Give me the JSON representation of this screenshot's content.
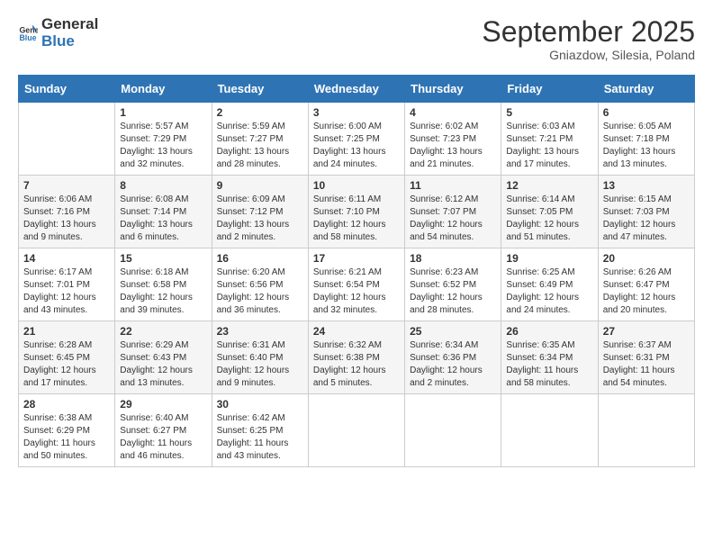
{
  "logo": {
    "general": "General",
    "blue": "Blue"
  },
  "title": "September 2025",
  "subtitle": "Gniazdow, Silesia, Poland",
  "weekdays": [
    "Sunday",
    "Monday",
    "Tuesday",
    "Wednesday",
    "Thursday",
    "Friday",
    "Saturday"
  ],
  "weeks": [
    [
      {
        "day": "",
        "info": ""
      },
      {
        "day": "1",
        "info": "Sunrise: 5:57 AM\nSunset: 7:29 PM\nDaylight: 13 hours\nand 32 minutes."
      },
      {
        "day": "2",
        "info": "Sunrise: 5:59 AM\nSunset: 7:27 PM\nDaylight: 13 hours\nand 28 minutes."
      },
      {
        "day": "3",
        "info": "Sunrise: 6:00 AM\nSunset: 7:25 PM\nDaylight: 13 hours\nand 24 minutes."
      },
      {
        "day": "4",
        "info": "Sunrise: 6:02 AM\nSunset: 7:23 PM\nDaylight: 13 hours\nand 21 minutes."
      },
      {
        "day": "5",
        "info": "Sunrise: 6:03 AM\nSunset: 7:21 PM\nDaylight: 13 hours\nand 17 minutes."
      },
      {
        "day": "6",
        "info": "Sunrise: 6:05 AM\nSunset: 7:18 PM\nDaylight: 13 hours\nand 13 minutes."
      }
    ],
    [
      {
        "day": "7",
        "info": "Sunrise: 6:06 AM\nSunset: 7:16 PM\nDaylight: 13 hours\nand 9 minutes."
      },
      {
        "day": "8",
        "info": "Sunrise: 6:08 AM\nSunset: 7:14 PM\nDaylight: 13 hours\nand 6 minutes."
      },
      {
        "day": "9",
        "info": "Sunrise: 6:09 AM\nSunset: 7:12 PM\nDaylight: 13 hours\nand 2 minutes."
      },
      {
        "day": "10",
        "info": "Sunrise: 6:11 AM\nSunset: 7:10 PM\nDaylight: 12 hours\nand 58 minutes."
      },
      {
        "day": "11",
        "info": "Sunrise: 6:12 AM\nSunset: 7:07 PM\nDaylight: 12 hours\nand 54 minutes."
      },
      {
        "day": "12",
        "info": "Sunrise: 6:14 AM\nSunset: 7:05 PM\nDaylight: 12 hours\nand 51 minutes."
      },
      {
        "day": "13",
        "info": "Sunrise: 6:15 AM\nSunset: 7:03 PM\nDaylight: 12 hours\nand 47 minutes."
      }
    ],
    [
      {
        "day": "14",
        "info": "Sunrise: 6:17 AM\nSunset: 7:01 PM\nDaylight: 12 hours\nand 43 minutes."
      },
      {
        "day": "15",
        "info": "Sunrise: 6:18 AM\nSunset: 6:58 PM\nDaylight: 12 hours\nand 39 minutes."
      },
      {
        "day": "16",
        "info": "Sunrise: 6:20 AM\nSunset: 6:56 PM\nDaylight: 12 hours\nand 36 minutes."
      },
      {
        "day": "17",
        "info": "Sunrise: 6:21 AM\nSunset: 6:54 PM\nDaylight: 12 hours\nand 32 minutes."
      },
      {
        "day": "18",
        "info": "Sunrise: 6:23 AM\nSunset: 6:52 PM\nDaylight: 12 hours\nand 28 minutes."
      },
      {
        "day": "19",
        "info": "Sunrise: 6:25 AM\nSunset: 6:49 PM\nDaylight: 12 hours\nand 24 minutes."
      },
      {
        "day": "20",
        "info": "Sunrise: 6:26 AM\nSunset: 6:47 PM\nDaylight: 12 hours\nand 20 minutes."
      }
    ],
    [
      {
        "day": "21",
        "info": "Sunrise: 6:28 AM\nSunset: 6:45 PM\nDaylight: 12 hours\nand 17 minutes."
      },
      {
        "day": "22",
        "info": "Sunrise: 6:29 AM\nSunset: 6:43 PM\nDaylight: 12 hours\nand 13 minutes."
      },
      {
        "day": "23",
        "info": "Sunrise: 6:31 AM\nSunset: 6:40 PM\nDaylight: 12 hours\nand 9 minutes."
      },
      {
        "day": "24",
        "info": "Sunrise: 6:32 AM\nSunset: 6:38 PM\nDaylight: 12 hours\nand 5 minutes."
      },
      {
        "day": "25",
        "info": "Sunrise: 6:34 AM\nSunset: 6:36 PM\nDaylight: 12 hours\nand 2 minutes."
      },
      {
        "day": "26",
        "info": "Sunrise: 6:35 AM\nSunset: 6:34 PM\nDaylight: 11 hours\nand 58 minutes."
      },
      {
        "day": "27",
        "info": "Sunrise: 6:37 AM\nSunset: 6:31 PM\nDaylight: 11 hours\nand 54 minutes."
      }
    ],
    [
      {
        "day": "28",
        "info": "Sunrise: 6:38 AM\nSunset: 6:29 PM\nDaylight: 11 hours\nand 50 minutes."
      },
      {
        "day": "29",
        "info": "Sunrise: 6:40 AM\nSunset: 6:27 PM\nDaylight: 11 hours\nand 46 minutes."
      },
      {
        "day": "30",
        "info": "Sunrise: 6:42 AM\nSunset: 6:25 PM\nDaylight: 11 hours\nand 43 minutes."
      },
      {
        "day": "",
        "info": ""
      },
      {
        "day": "",
        "info": ""
      },
      {
        "day": "",
        "info": ""
      },
      {
        "day": "",
        "info": ""
      }
    ]
  ]
}
